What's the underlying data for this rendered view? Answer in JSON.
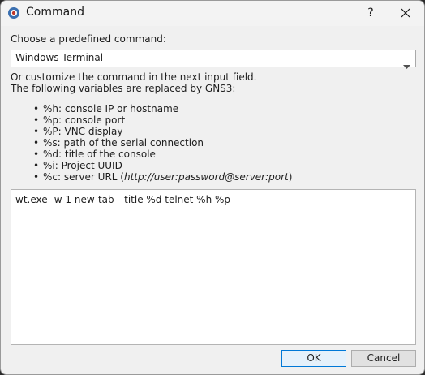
{
  "window": {
    "title": "Command",
    "help_label": "?"
  },
  "form": {
    "predefined_label": "Choose a predefined command:",
    "selected_command": "Windows Terminal",
    "customize_line1": "Or customize the command in the next input field.",
    "customize_line2": "The following variables are replaced by GNS3:",
    "variables": [
      {
        "code": "%h",
        "desc": ": console IP or hostname"
      },
      {
        "code": "%p",
        "desc": ": console port"
      },
      {
        "code": "%P",
        "desc": ": VNC display"
      },
      {
        "code": "%s",
        "desc": ": path of the serial connection"
      },
      {
        "code": "%d",
        "desc": ": title of the console"
      },
      {
        "code": "%i",
        "desc": ": Project UUID"
      },
      {
        "code": "%c",
        "desc": ": server URL (",
        "example": "http://user:password@server:port",
        "suffix": ")"
      }
    ],
    "command_value": "wt.exe -w 1 new-tab --title %d telnet %h %p"
  },
  "buttons": {
    "ok": "OK",
    "cancel": "Cancel"
  },
  "colors": {
    "accent": "#0078d7",
    "background": "#f0f0f0"
  },
  "icons": {
    "app": "gns3-app-icon",
    "close": "close-icon",
    "dropdown": "chevron-down-icon"
  }
}
